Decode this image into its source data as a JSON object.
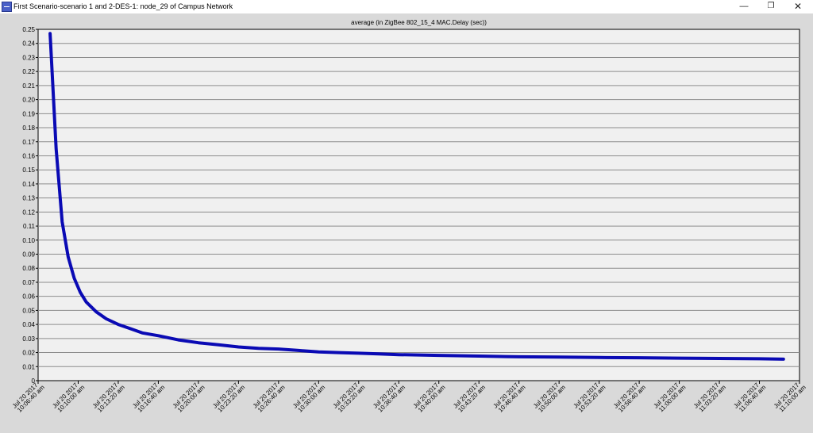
{
  "window": {
    "title": "First Scenario-scenario 1 and 2-DES-1: node_29 of Campus Network",
    "minimize_glyph": "—",
    "maximize_glyph": "❐",
    "close_glyph": "✕"
  },
  "chart_data": {
    "type": "line",
    "title": "average (in ZigBee 802_15_4 MAC.Delay (sec))",
    "xlabel": "",
    "ylabel": "",
    "ylim": [
      0,
      0.25
    ],
    "y_ticks": [
      0,
      0.01,
      0.02,
      0.03,
      0.04,
      0.05,
      0.06,
      0.07,
      0.08,
      0.09,
      0.1,
      0.11,
      0.12,
      0.13,
      0.14,
      0.15,
      0.16,
      0.17,
      0.18,
      0.19,
      0.2,
      0.21,
      0.22,
      0.23,
      0.24,
      0.25
    ],
    "y_tick_labels": [
      "0",
      "0.01",
      "0.02",
      "0.03",
      "0.04",
      "0.05",
      "0.06",
      "0.07",
      "0.08",
      "0.09",
      "0.10",
      "0.11",
      "0.12",
      "0.13",
      "0.14",
      "0.15",
      "0.16",
      "0.17",
      "0.18",
      "0.19",
      "0.20",
      "0.21",
      "0.22",
      "0.23",
      "0.24",
      "0.25"
    ],
    "x_tick_labels": [
      [
        "Jul 20 2017",
        "10:06:40 am"
      ],
      [
        "Jul 20 2017",
        "10:10:00 am"
      ],
      [
        "Jul 20 2017",
        "10:13:20 am"
      ],
      [
        "Jul 20 2017",
        "10:16:40 am"
      ],
      [
        "Jul 20 2017",
        "10:20:00 am"
      ],
      [
        "Jul 20 2017",
        "10:23:20 am"
      ],
      [
        "Jul 20 2017",
        "10:26:40 am"
      ],
      [
        "Jul 20 2017",
        "10:30:00 am"
      ],
      [
        "Jul 20 2017",
        "10:33:20 am"
      ],
      [
        "Jul 20 2017",
        "10:36:40 am"
      ],
      [
        "Jul 20 2017",
        "10:40:00 am"
      ],
      [
        "Jul 20 2017",
        "10:43:20 am"
      ],
      [
        "Jul 20 2017",
        "10:46:40 am"
      ],
      [
        "Jul 20 2017",
        "10:50:00 am"
      ],
      [
        "Jul 20 2017",
        "10:53:20 am"
      ],
      [
        "Jul 20 2017",
        "10:56:40 am"
      ],
      [
        "Jul 20 2017",
        "11:00:00 am"
      ],
      [
        "Jul 20 2017",
        "11:03:20 am"
      ],
      [
        "Jul 20 2017",
        "11:06:40 am"
      ],
      [
        "Jul 20 2017",
        "11:10:00 am"
      ]
    ],
    "grid": true,
    "line_color": "#0a0ab4",
    "series": [
      {
        "x": [
          "10:07:40",
          "10:08:10",
          "10:08:40",
          "10:09:10",
          "10:09:40",
          "10:10:10",
          "10:10:40",
          "10:11:30",
          "10:12:20",
          "10:13:20",
          "10:14:20",
          "10:15:20",
          "10:16:40",
          "10:18:20",
          "10:20:00",
          "10:21:40",
          "10:23:20",
          "10:25:00",
          "10:26:40",
          "10:28:20",
          "10:30:00",
          "10:31:40",
          "10:33:20",
          "10:35:00",
          "10:36:40",
          "10:40:00",
          "10:43:20",
          "10:46:40",
          "10:50:00",
          "10:53:20",
          "10:56:40",
          "11:00:00",
          "11:03:20",
          "11:06:40",
          "11:08:40"
        ],
        "y": [
          0.247,
          0.165,
          0.113,
          0.088,
          0.073,
          0.063,
          0.056,
          0.049,
          0.044,
          0.04,
          0.037,
          0.034,
          0.032,
          0.029,
          0.027,
          0.0255,
          0.024,
          0.023,
          0.0225,
          0.0215,
          0.0205,
          0.02,
          0.0195,
          0.019,
          0.0185,
          0.018,
          0.0175,
          0.017,
          0.0168,
          0.0165,
          0.0163,
          0.016,
          0.0158,
          0.0156,
          0.0153
        ]
      }
    ]
  }
}
